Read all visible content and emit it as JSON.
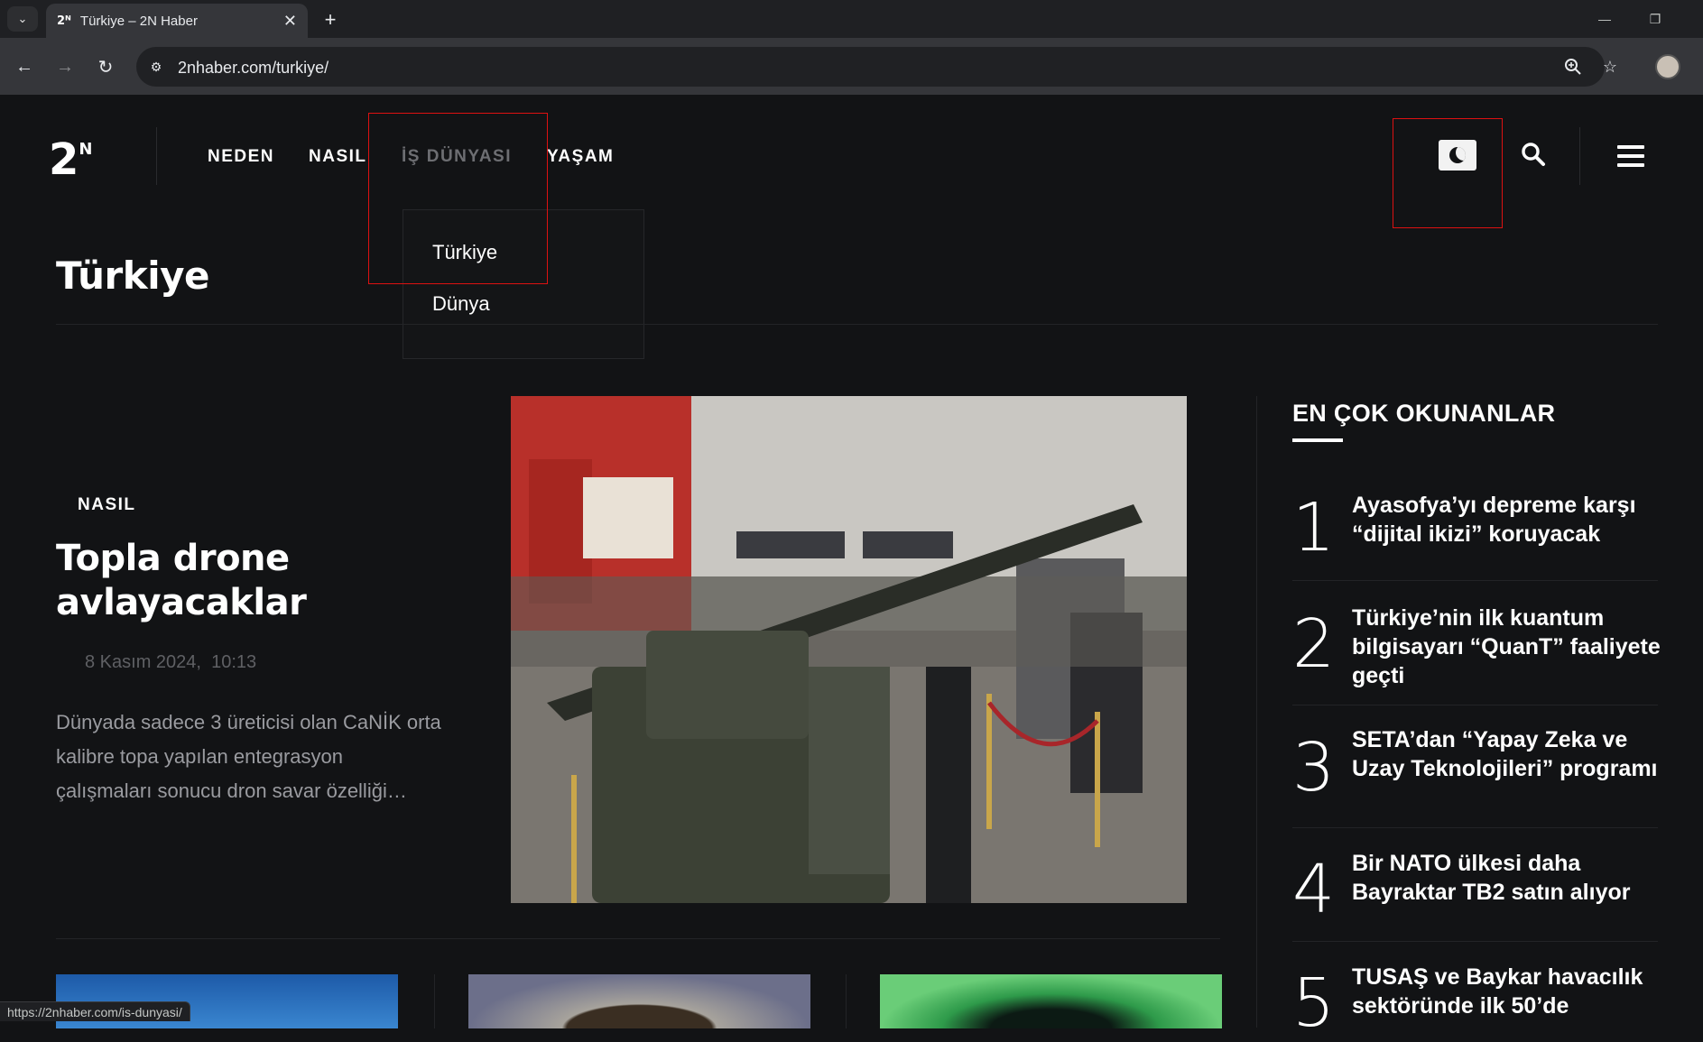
{
  "browser": {
    "tab_title": "Türkiye – 2N Haber",
    "tab_favicon": "2ᴺ",
    "url": "2nhaber.com/turkiye/",
    "status_url": "https://2nhaber.com/is-dunyasi/",
    "icons": {
      "tab_list": "chevron-down-icon",
      "close": "close-icon",
      "new_tab": "plus-icon",
      "back": "back-arrow-icon",
      "forward": "forward-arrow-icon",
      "reload": "reload-icon",
      "site_info": "tune-icon",
      "zoom": "zoom-icon",
      "bookmark": "star-icon"
    }
  },
  "site": {
    "logo": "2",
    "logo_sup": "N",
    "nav": {
      "neden": "NEDEN",
      "nasil": "NASIL",
      "is_dunyasi": "İŞ DÜNYASI",
      "yasam": "YAŞAM"
    },
    "dropdown": [
      "Türkiye",
      "Dünya"
    ],
    "page_title": "Türkiye",
    "featured": {
      "category": "NASIL",
      "headline": "Topla drone avlayacaklar",
      "date": "8 Kasım 2024,",
      "time": "10:13",
      "excerpt": "Dünyada sadece 3 üreticisi olan CaNİK orta kalibre topa yapılan entegrasyon çalışmaları sonucu dron savar özelliği…"
    },
    "most_read": {
      "title": "EN ÇOK OKUNANLAR",
      "items": [
        {
          "num": "1",
          "text": "Ayasofya’yı depreme karşı “dijital ikizi” koruyacak"
        },
        {
          "num": "2",
          "text": "Türkiye’nin ilk kuantum bilgisayarı “QuanT” faaliyete geçti"
        },
        {
          "num": "3",
          "text": "SETA’dan “Yapay Zeka ve Uzay Teknolojileri” programı"
        },
        {
          "num": "4",
          "text": "Bir NATO ülkesi daha Bayraktar TB2 satın alıyor"
        },
        {
          "num": "5",
          "text": "TUSAŞ ve Baykar havacılık sektöründe ilk 50’de"
        }
      ]
    },
    "colors": {
      "background": "#121315",
      "highlight_box": "#dd1111",
      "muted_nav": "#6d6e72"
    }
  }
}
